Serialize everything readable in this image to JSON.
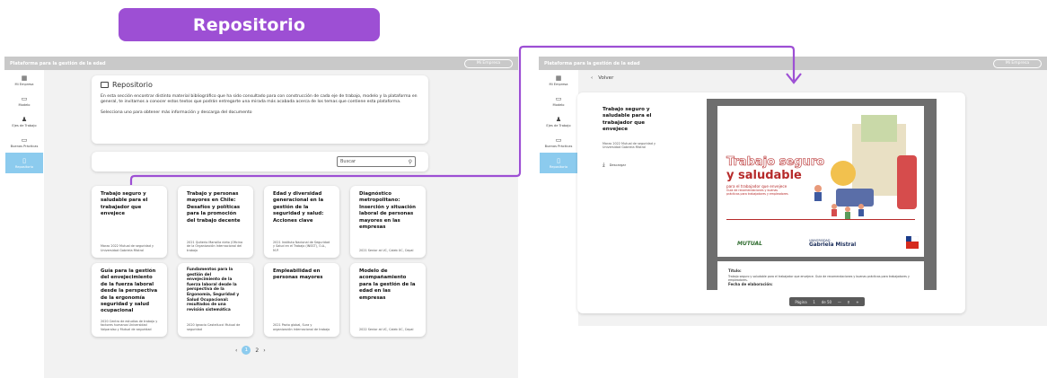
{
  "title": "Repositorio",
  "left_screen": {
    "brand": "Plataforma para la gestión de la edad",
    "company_button": "Mi Empresa",
    "sidebar": [
      {
        "icon": "grid-icon",
        "glyph": "▦",
        "label": "Mi Empresa",
        "active": false
      },
      {
        "icon": "folder-icon",
        "glyph": "▭",
        "label": "Modelo",
        "active": false
      },
      {
        "icon": "people-icon",
        "glyph": "♟",
        "label": "Ejes de Trabajo",
        "active": false
      },
      {
        "icon": "folder-icon",
        "glyph": "▭",
        "label": "Buenas Prácticas",
        "active": false
      },
      {
        "icon": "document-icon",
        "glyph": "▯",
        "label": "Repositorio",
        "active": true
      }
    ],
    "info": {
      "heading": "Repositorio",
      "paragraph1": "En esta sección encontrar distinto material bibliográfico que ha sido consultado para con construcción de cada eje de trabajo, modelo y la plataforma en general, te invitamos a conocer estos textos que podrán entregarte una mirada más acabada acerca de los temas que contiene esta plataforma.",
      "paragraph2": "Selecciona uno para obtener más información y descarga del documento"
    },
    "search_placeholder": "Buscar",
    "cards": [
      {
        "title": "Trabajo seguro y saludable para el trabajador que envejece",
        "meta": "Marzo 2022 Mutual de seguridad y Universidad Gabriela Mistral"
      },
      {
        "title": "Trabajo y personas mayores en Chile: Desafíos y políticas para la promoción del trabajo decente",
        "meta": "2021 Quiterio Mansilla nieto (Oficina de la Organización Internacional del trabajo"
      },
      {
        "title": "Edad y diversidad generacional en la gestión de la seguridad y salud: Acciones clave",
        "meta": "2021 Instituto Nacional de Seguridad y Salud en el Trabajo (INSST), O.A., M.P."
      },
      {
        "title": "Diagnóstico metropolitano: Inserción y situación laboral de personas mayores en las empresas",
        "meta": "2021 Senior at UC, Caleb UC, Cepal"
      },
      {
        "title": "Guía para la gestión del envejecimiento de la fuerza laboral desde la perspectiva de la ergonomía seguridad y salud ocupacional",
        "meta": "2020 Centro de estudios de trabajo y factores humanos Universidad Valparaíso y Mutual de seguridad"
      },
      {
        "title": "Fundamentos para la gestión del envejecimiento de la fuerza laboral desde la perspectiva de la Ergonomía, Seguridad y Salud Ocupacional: resultados de una revisión sistemática",
        "meta": "2020 Ignacio Castellucci Mutual de seguridad"
      },
      {
        "title": "Empleabilidad en personas mayores",
        "meta": "2021 Pacto global, Sura y organización internacional de trabajo"
      },
      {
        "title": "Modelo de acompañamiento para la gestión de la edad en las empresas",
        "meta": "2022 Senior at UC, Caleb UC, Cepal"
      }
    ],
    "pagination": {
      "prev": "‹",
      "page1": "1",
      "page2": "2",
      "next": "›"
    }
  },
  "right_screen": {
    "brand": "Plataforma para la gestión de la edad",
    "company_button": "Mi Empresa",
    "back_label": "Volver",
    "doc_title": "Trabajo seguro y saludable para el trabajador que envejece",
    "doc_meta": "Marzo 2022 Mutual de seguridad y Universidad Gabriela Mistral",
    "download_label": "Descargar",
    "cover": {
      "line1": "Trabajo seguro",
      "line2": "y saludable",
      "line3": "para el trabajador que envejece",
      "line4": "Guía de recomendaciones y buenas prácticas para trabajadores y empleadores",
      "logo_mutual": "MUTUAL",
      "logo_gm_small": "UNIVERSIDAD",
      "logo_gm": "Gabriela Mistral"
    },
    "page2": {
      "heading": "Título:",
      "text": "Trabajo seguro y saludable para el trabajador que envejece. Guía de recomendaciones y buenas prácticas para trabajadores y empleadores.",
      "heading2": "Fecha de elaboración:"
    },
    "pdf_toolbar": {
      "page_label": "Página",
      "page_value": "1",
      "of_label": "de 50",
      "zoom_out": "—",
      "zoom_icon": "🔍",
      "zoom_in": "+"
    }
  },
  "colors": {
    "accent_purple": "#9d4fd4",
    "active_blue": "#8ccbee",
    "cover_red": "#b62a2a"
  }
}
